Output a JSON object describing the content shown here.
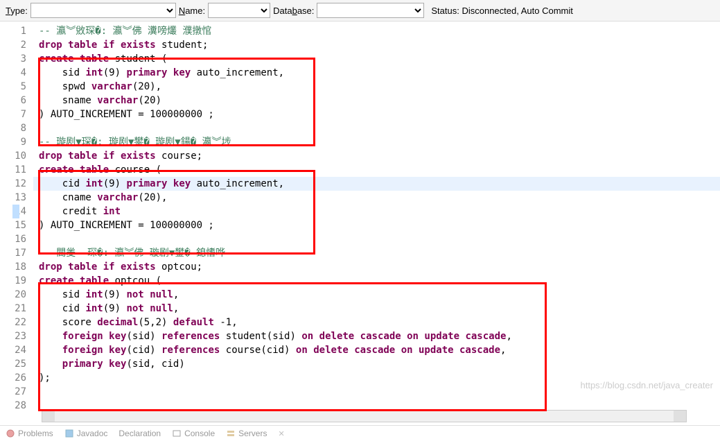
{
  "toolbar": {
    "type_label": "Type:",
    "name_label": "Name:",
    "database_label": "Database:",
    "status_text": "Status: Disconnected, Auto Commit"
  },
  "code": {
    "lines": [
      {
        "n": 1,
        "segs": [
          {
            "t": "-- 瀛︾敓琛�: 瀛︾佛 瀵嗙爜 濮撴悺",
            "c": "comment"
          }
        ]
      },
      {
        "n": 2,
        "segs": [
          {
            "t": "drop",
            "c": "kw"
          },
          {
            "t": " "
          },
          {
            "t": "table",
            "c": "kw"
          },
          {
            "t": " "
          },
          {
            "t": "if",
            "c": "kw"
          },
          {
            "t": " "
          },
          {
            "t": "exists",
            "c": "kw"
          },
          {
            "t": " student;"
          }
        ]
      },
      {
        "n": 3,
        "segs": [
          {
            "t": "create",
            "c": "kw"
          },
          {
            "t": " "
          },
          {
            "t": "table",
            "c": "kw"
          },
          {
            "t": " student ("
          }
        ]
      },
      {
        "n": 4,
        "segs": [
          {
            "t": "    sid "
          },
          {
            "t": "int",
            "c": "kw"
          },
          {
            "t": "(9) "
          },
          {
            "t": "primary",
            "c": "kw"
          },
          {
            "t": " "
          },
          {
            "t": "key",
            "c": "kw"
          },
          {
            "t": " auto_increment,"
          }
        ]
      },
      {
        "n": 5,
        "segs": [
          {
            "t": "    spwd "
          },
          {
            "t": "varchar",
            "c": "kw"
          },
          {
            "t": "(20),"
          }
        ]
      },
      {
        "n": 6,
        "segs": [
          {
            "t": "    sname "
          },
          {
            "t": "varchar",
            "c": "kw"
          },
          {
            "t": "(20)"
          }
        ]
      },
      {
        "n": 7,
        "segs": [
          {
            "t": ") AUTO_INCREMENT = 100000000 ;"
          }
        ]
      },
      {
        "n": 8,
        "segs": [
          {
            "t": ""
          }
        ]
      },
      {
        "n": 9,
        "segs": [
          {
            "t": "-- 璇剧▼琛�: 璇剧▼鐢� 璇剧▼鍚� 瀛︾埗",
            "c": "comment"
          }
        ]
      },
      {
        "n": 10,
        "segs": [
          {
            "t": "drop",
            "c": "kw"
          },
          {
            "t": " "
          },
          {
            "t": "table",
            "c": "kw"
          },
          {
            "t": " "
          },
          {
            "t": "if",
            "c": "kw"
          },
          {
            "t": " "
          },
          {
            "t": "exists",
            "c": "kw"
          },
          {
            "t": " course;"
          }
        ]
      },
      {
        "n": 11,
        "segs": [
          {
            "t": "create",
            "c": "kw"
          },
          {
            "t": " "
          },
          {
            "t": "table",
            "c": "kw"
          },
          {
            "t": " course ("
          }
        ]
      },
      {
        "n": 12,
        "hl": true,
        "segs": [
          {
            "t": "    cid "
          },
          {
            "t": "int",
            "c": "kw"
          },
          {
            "t": "(9) "
          },
          {
            "t": "primary",
            "c": "kw"
          },
          {
            "t": " "
          },
          {
            "t": "key",
            "c": "kw"
          },
          {
            "t": " auto_increment,"
          }
        ]
      },
      {
        "n": 13,
        "segs": [
          {
            "t": "    cname "
          },
          {
            "t": "varchar",
            "c": "kw"
          },
          {
            "t": "(20),"
          }
        ]
      },
      {
        "n": 14,
        "segs": [
          {
            "t": "    credit "
          },
          {
            "t": "int",
            "c": "kw"
          }
        ]
      },
      {
        "n": 15,
        "segs": [
          {
            "t": ") AUTO_INCREMENT = 100000000 ;"
          }
        ]
      },
      {
        "n": 16,
        "segs": [
          {
            "t": ""
          }
        ]
      },
      {
        "n": 17,
        "segs": [
          {
            "t": "-- 閫夎  琛�: 瀛︾佛 璇剧▼鐢� 鎴愭哗",
            "c": "comment"
          }
        ]
      },
      {
        "n": 18,
        "segs": [
          {
            "t": "drop",
            "c": "kw"
          },
          {
            "t": " "
          },
          {
            "t": "table",
            "c": "kw"
          },
          {
            "t": " "
          },
          {
            "t": "if",
            "c": "kw"
          },
          {
            "t": " "
          },
          {
            "t": "exists",
            "c": "kw"
          },
          {
            "t": " optcou;"
          }
        ]
      },
      {
        "n": 19,
        "segs": [
          {
            "t": "create",
            "c": "kw"
          },
          {
            "t": " "
          },
          {
            "t": "table",
            "c": "kw"
          },
          {
            "t": " optcou ("
          }
        ]
      },
      {
        "n": 20,
        "segs": [
          {
            "t": "    sid "
          },
          {
            "t": "int",
            "c": "kw"
          },
          {
            "t": "(9) "
          },
          {
            "t": "not",
            "c": "kw"
          },
          {
            "t": " "
          },
          {
            "t": "null",
            "c": "kw"
          },
          {
            "t": ","
          }
        ]
      },
      {
        "n": 21,
        "segs": [
          {
            "t": "    cid "
          },
          {
            "t": "int",
            "c": "kw"
          },
          {
            "t": "(9) "
          },
          {
            "t": "not",
            "c": "kw"
          },
          {
            "t": " "
          },
          {
            "t": "null",
            "c": "kw"
          },
          {
            "t": ","
          }
        ]
      },
      {
        "n": 22,
        "segs": [
          {
            "t": "    score "
          },
          {
            "t": "decimal",
            "c": "kw"
          },
          {
            "t": "(5,2) "
          },
          {
            "t": "default",
            "c": "kw"
          },
          {
            "t": " -1,"
          }
        ]
      },
      {
        "n": 23,
        "segs": [
          {
            "t": "    "
          },
          {
            "t": "foreign",
            "c": "kw"
          },
          {
            "t": " "
          },
          {
            "t": "key",
            "c": "kw"
          },
          {
            "t": "(sid) "
          },
          {
            "t": "references",
            "c": "kw"
          },
          {
            "t": " student(sid) "
          },
          {
            "t": "on",
            "c": "kw"
          },
          {
            "t": " "
          },
          {
            "t": "delete",
            "c": "kw"
          },
          {
            "t": " "
          },
          {
            "t": "cascade",
            "c": "kw"
          },
          {
            "t": " "
          },
          {
            "t": "on",
            "c": "kw"
          },
          {
            "t": " "
          },
          {
            "t": "update",
            "c": "kw"
          },
          {
            "t": " "
          },
          {
            "t": "cascade",
            "c": "kw"
          },
          {
            "t": ","
          }
        ]
      },
      {
        "n": 24,
        "segs": [
          {
            "t": "    "
          },
          {
            "t": "foreign",
            "c": "kw"
          },
          {
            "t": " "
          },
          {
            "t": "key",
            "c": "kw"
          },
          {
            "t": "(cid) "
          },
          {
            "t": "references",
            "c": "kw"
          },
          {
            "t": " course(cid) "
          },
          {
            "t": "on",
            "c": "kw"
          },
          {
            "t": " "
          },
          {
            "t": "delete",
            "c": "kw"
          },
          {
            "t": " "
          },
          {
            "t": "cascade",
            "c": "kw"
          },
          {
            "t": " "
          },
          {
            "t": "on",
            "c": "kw"
          },
          {
            "t": " "
          },
          {
            "t": "update",
            "c": "kw"
          },
          {
            "t": " "
          },
          {
            "t": "cascade",
            "c": "kw"
          },
          {
            "t": ","
          }
        ]
      },
      {
        "n": 25,
        "segs": [
          {
            "t": "    "
          },
          {
            "t": "primary",
            "c": "kw"
          },
          {
            "t": " "
          },
          {
            "t": "key",
            "c": "kw"
          },
          {
            "t": "(sid, cid)"
          }
        ]
      },
      {
        "n": 26,
        "segs": [
          {
            "t": ");"
          }
        ]
      },
      {
        "n": 27,
        "segs": [
          {
            "t": ""
          }
        ]
      },
      {
        "n": 28,
        "segs": [
          {
            "t": ""
          }
        ]
      }
    ]
  },
  "bottom_tabs": {
    "problems": "Problems",
    "javadoc": "Javadoc",
    "declaration": "Declaration",
    "console": "Console",
    "servers": "Servers"
  },
  "watermark": "https://blog.csdn.net/java_creater"
}
